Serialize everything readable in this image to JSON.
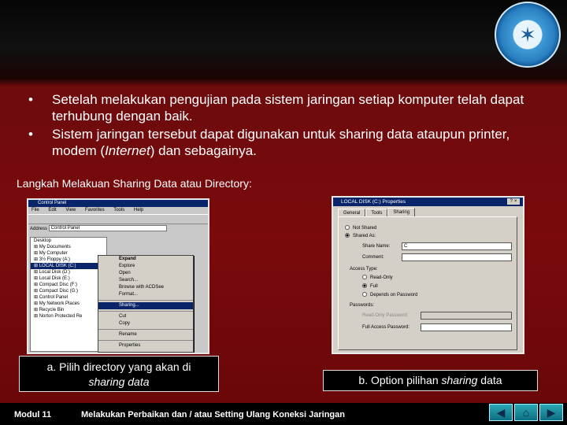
{
  "bullets": [
    "Setelah melakukan pengujian pada sistem jaringan setiap komputer telah dapat terhubung dengan baik.",
    "Sistem jaringan tersebut dapat digunakan untuk sharing data ataupun printer, modem (Internet) dan sebagainya."
  ],
  "bullet_glyph": "•",
  "subheading": "Langkah Melakuan Sharing Data atau Directory:",
  "screenshot1": {
    "title": "Control Panel",
    "menu": [
      "File",
      "Edit",
      "View",
      "Favorites",
      "Tools",
      "Help"
    ],
    "address_label": "Address",
    "address_value": "Control Panel",
    "tree": [
      "Desktop",
      "My Documents",
      "My Computer",
      "3½ Floppy (A:)",
      "LOCAL DISK (C:)",
      "Local Disk (D:)",
      "Local Disk (E:)",
      "Compact Disc (F:)",
      "Compact Disc (G:)",
      "Control Panel",
      "My Network Places",
      "Recycle Bin",
      "Norton Protected Re"
    ],
    "tree_selected": "LOCAL DISK (C:)",
    "context_menu": [
      "Expand",
      "Explore",
      "Open",
      "Search...",
      "Browse with ACDSee",
      "Format...",
      "Sharing...",
      "Cut",
      "Copy",
      "Rename",
      "Properties"
    ],
    "context_highlighted": "Sharing..."
  },
  "screenshot2": {
    "title": "LOCAL DISK (C:) Properties",
    "tabs": [
      "General",
      "Tools",
      "Sharing"
    ],
    "active_tab": "Sharing",
    "options": [
      "Not Shared",
      "Shared As:"
    ],
    "share_name_label": "Share Name:",
    "share_name_value": "C",
    "comment_label": "Comment:",
    "access_type_label": "Access Type:",
    "access_options": [
      "Read-Only",
      "Full",
      "Depends on Password"
    ],
    "passwords_label": "Passwords:",
    "read_only_pw_label": "Read-Only Password:",
    "full_access_pw_label": "Full Access Password:"
  },
  "caption1": [
    "a. Pilih directory yang akan di",
    "sharing data"
  ],
  "caption2_prefix": "b. Option pilihan ",
  "caption2_italic": "sharing",
  "caption2_suffix": " data",
  "footer": {
    "module": "Modul 11",
    "title": "Melakukan Perbaikan dan / atau Setting Ulang Koneksi Jaringan"
  },
  "colors": {
    "slide_background": "#7a0a0c",
    "caption_background": "#000000",
    "nav_button": "#1a8fa0"
  },
  "icons": [
    "logo-emblem",
    "back-arrow-icon",
    "home-icon",
    "forward-arrow-icon"
  ]
}
